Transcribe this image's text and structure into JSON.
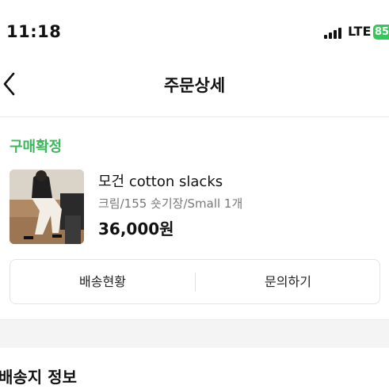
{
  "status_bar": {
    "time": "11:18",
    "network": "LTE",
    "battery": "85"
  },
  "header": {
    "title": "주문상세",
    "back_icon": "chevron-left-icon"
  },
  "order": {
    "status": "구매확정",
    "status_color": "#3cb85a",
    "product": {
      "name": "모건 cotton slacks",
      "option": "크림/155 숏기장/Small 1개",
      "price": "36,000원"
    },
    "actions": {
      "tracking_label": "배송현황",
      "inquiry_label": "문의하기"
    }
  },
  "shipping": {
    "title": "배송지 정보"
  }
}
